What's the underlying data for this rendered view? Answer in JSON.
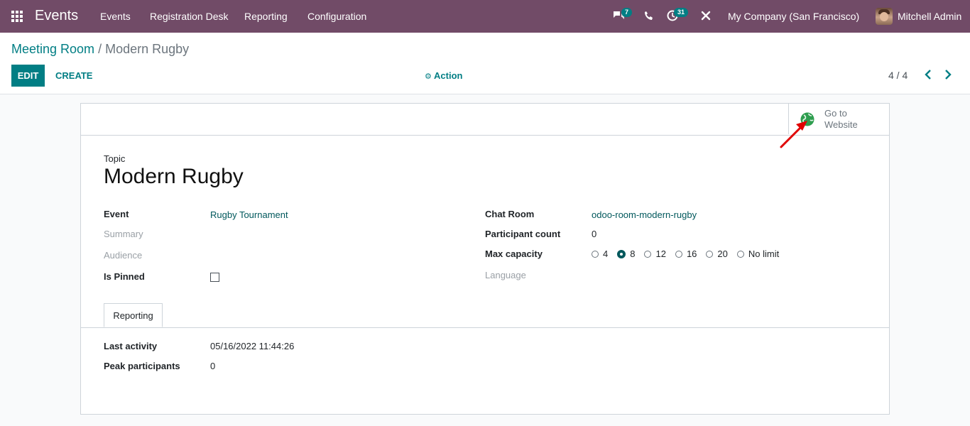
{
  "navbar": {
    "app_name": "Events",
    "menu": [
      "Events",
      "Registration Desk",
      "Reporting",
      "Configuration"
    ],
    "messages_count": "7",
    "activities_count": "31",
    "company": "My Company (San Francisco)",
    "user": "Mitchell Admin"
  },
  "breadcrumb": {
    "parent": "Meeting Room",
    "separator": "/",
    "current": "Modern Rugby"
  },
  "toolbar": {
    "edit_label": "EDIT",
    "create_label": "CREATE",
    "action_label": "Action",
    "pager": "4 / 4"
  },
  "button_box": {
    "website_line1": "Go to",
    "website_line2": "Website"
  },
  "form": {
    "topic_label": "Topic",
    "title": "Modern Rugby",
    "left": {
      "event_label": "Event",
      "event_value": "Rugby Tournament",
      "summary_label": "Summary",
      "audience_label": "Audience",
      "pinned_label": "Is Pinned",
      "pinned": false
    },
    "right": {
      "chat_room_label": "Chat Room",
      "chat_room_value": "odoo-room-modern-rugby",
      "participant_label": "Participant count",
      "participant_value": "0",
      "capacity_label": "Max capacity",
      "capacity_options": [
        "4",
        "8",
        "12",
        "16",
        "20",
        "No limit"
      ],
      "capacity_selected": "8",
      "language_label": "Language"
    }
  },
  "tabs": {
    "reporting_label": "Reporting"
  },
  "reporting": {
    "last_activity_label": "Last activity",
    "last_activity_value": "05/16/2022 11:44:26",
    "peak_label": "Peak participants",
    "peak_value": "0"
  },
  "colors": {
    "navbar": "#714b67",
    "primary": "#017e84",
    "link": "#01585c",
    "annotation_arrow": "#e00000",
    "globe": "#2e9e4f"
  }
}
